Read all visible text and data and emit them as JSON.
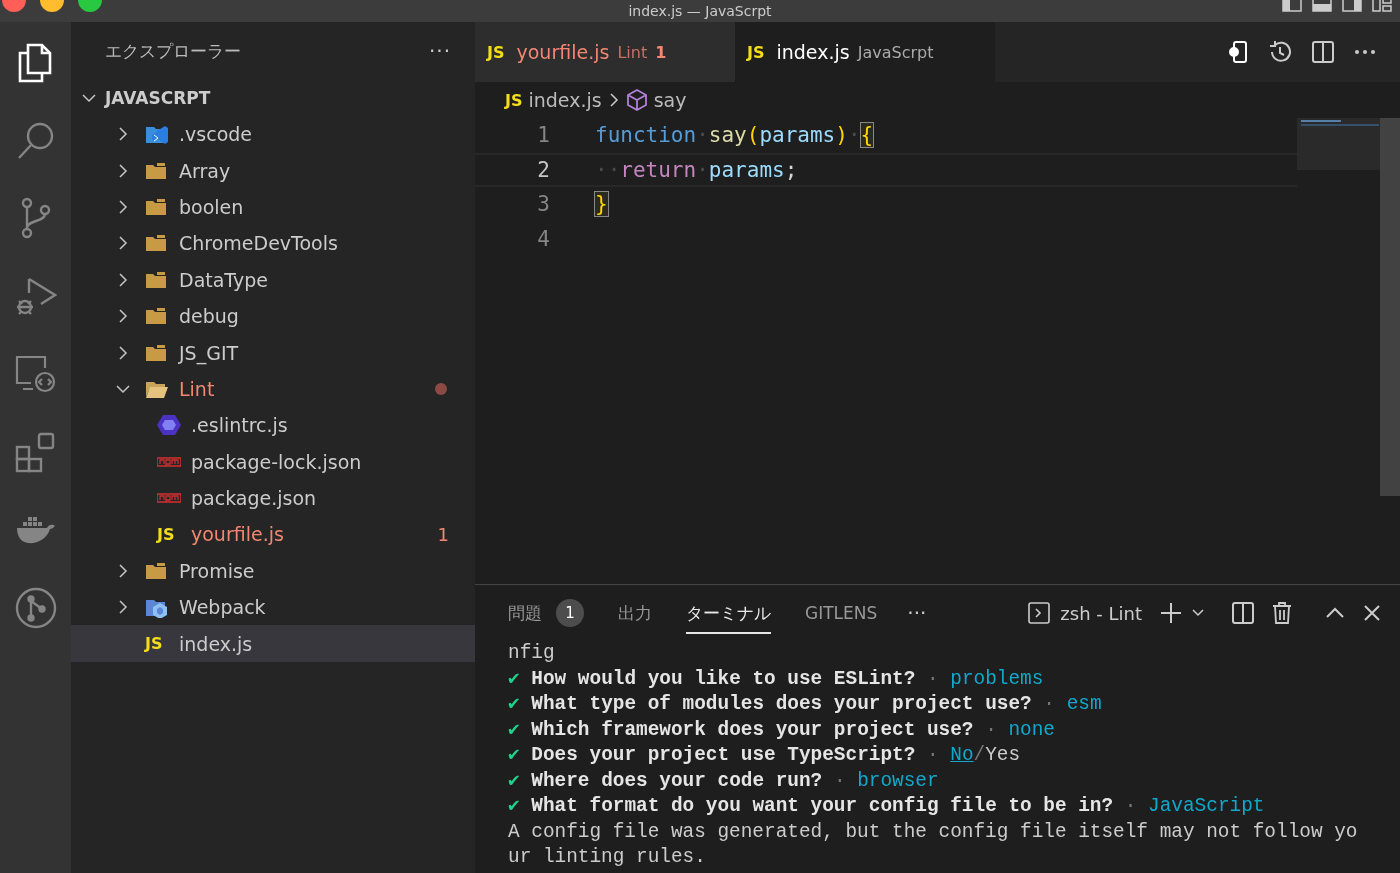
{
  "window": {
    "title": "index.js — JavaScrpt"
  },
  "activity_bar": [
    {
      "selected": true
    },
    {
      "selected": false
    },
    {
      "selected": false
    },
    {
      "selected": false
    },
    {
      "selected": false
    },
    {
      "selected": false
    },
    {
      "selected": false
    },
    {
      "selected": false
    }
  ],
  "sidebar": {
    "title": "エクスプローラー",
    "more": "···",
    "tree": {
      "label": "JAVASCRPT",
      "expanded": true,
      "children": [
        {
          "label": ".vscode",
          "kind": "vscode-folder",
          "expanded": false,
          "selected": false,
          "error": false
        },
        {
          "label": "Array",
          "kind": "folder",
          "expanded": false,
          "selected": false,
          "error": false
        },
        {
          "label": "boolen",
          "kind": "folder",
          "expanded": false,
          "selected": false,
          "error": false
        },
        {
          "label": "ChromeDevTools",
          "kind": "folder",
          "expanded": false,
          "selected": false,
          "error": false
        },
        {
          "label": "DataType",
          "kind": "folder",
          "expanded": false,
          "selected": false,
          "error": false
        },
        {
          "label": "debug",
          "kind": "folder",
          "expanded": false,
          "selected": false,
          "error": false
        },
        {
          "label": "JS_GIT",
          "kind": "folder",
          "expanded": false,
          "selected": false,
          "error": false
        },
        {
          "label": "Lint",
          "kind": "folder",
          "expanded": true,
          "selected": false,
          "error": true,
          "dot": true,
          "children": [
            {
              "label": ".eslintrc.js",
              "kind": "eslint-file",
              "selected": false,
              "error": false
            },
            {
              "label": "package-lock.json",
              "kind": "npm-file",
              "selected": false,
              "error": false
            },
            {
              "label": "package.json",
              "kind": "npm-file",
              "selected": false,
              "error": false
            },
            {
              "label": "yourfile.js",
              "kind": "js-file",
              "icon_text": "JS",
              "selected": false,
              "error": true,
              "count": "1"
            }
          ]
        },
        {
          "label": "Promise",
          "kind": "folder",
          "expanded": false,
          "selected": false,
          "error": false
        },
        {
          "label": "Webpack",
          "kind": "webpack-folder",
          "expanded": false,
          "selected": false,
          "error": false
        },
        {
          "label": "index.js",
          "kind": "js-file",
          "icon_text": "JS",
          "selected": true,
          "error": false
        }
      ]
    }
  },
  "editor": {
    "tabs": [
      {
        "icon_text": "JS",
        "label": "yourfile.js",
        "description": "Lint",
        "count": "1",
        "error": true,
        "selected": false
      },
      {
        "icon_text": "JS",
        "label": "index.js",
        "description": "JavaScrpt",
        "error": false,
        "selected": true
      }
    ],
    "breadcrumb": {
      "icon_text": "JS",
      "file": "index.js",
      "symbol": "say"
    },
    "lines": [
      {
        "number": "1",
        "current": false,
        "tokens": [
          {
            "kind": "keyword",
            "text": "function"
          },
          {
            "kind": "ws",
            "text": "·"
          },
          {
            "kind": "function",
            "text": "say"
          },
          {
            "kind": "bracket",
            "text": "("
          },
          {
            "kind": "param",
            "text": "params"
          },
          {
            "kind": "bracket",
            "text": ")"
          },
          {
            "kind": "ws",
            "text": "·"
          },
          {
            "kind": "bracket",
            "text": "{",
            "matched": true
          }
        ]
      },
      {
        "number": "2",
        "current": true,
        "tokens": [
          {
            "kind": "ws",
            "text": "··"
          },
          {
            "kind": "control",
            "text": "return"
          },
          {
            "kind": "ws",
            "text": "·"
          },
          {
            "kind": "param",
            "text": "params"
          },
          {
            "kind": "punct",
            "text": ";"
          }
        ]
      },
      {
        "number": "3",
        "current": false,
        "tokens": [
          {
            "kind": "bracket",
            "text": "}",
            "matched": true
          }
        ]
      },
      {
        "number": "4",
        "current": false
      }
    ]
  },
  "panel": {
    "tabs": [
      {
        "label": "問題",
        "count": "1",
        "selected": false
      },
      {
        "label": "出力",
        "selected": false
      },
      {
        "label": "ターミナル",
        "selected": true
      },
      {
        "label": "GITLENS",
        "selected": false
      }
    ],
    "more": "···",
    "terminal_name": "zsh - Lint",
    "terminal": [
      {
        "kind": "plain",
        "text": "nfig"
      },
      {
        "kind": "answer",
        "check": "✔",
        "question": "How would you like to use ESLint?",
        "sep": "·",
        "answer": "problems"
      },
      {
        "kind": "answer",
        "check": "✔",
        "question": "What type of modules does your project use?",
        "sep": "·",
        "answer": "esm"
      },
      {
        "kind": "answer",
        "check": "✔",
        "question": "Which framework does your project use?",
        "sep": "·",
        "answer": "none"
      },
      {
        "kind": "choice",
        "check": "✔",
        "question": "Does your project use TypeScript?",
        "sep": "·",
        "options": [
          {
            "text": "No",
            "selected": true
          },
          {
            "text": "Yes",
            "selected": false
          }
        ],
        "option_sep": "/"
      },
      {
        "kind": "answer",
        "check": "✔",
        "question": "Where does your code run?",
        "sep": "·",
        "answer": "browser"
      },
      {
        "kind": "answer",
        "check": "✔",
        "question": "What format do you want your config file to be in?",
        "sep": "·",
        "answer": "JavaScript"
      },
      {
        "kind": "plain",
        "text": "A config file was generated, but the config file itself may not follow yo"
      },
      {
        "kind": "plain",
        "text": "ur linting rules."
      }
    ]
  }
}
